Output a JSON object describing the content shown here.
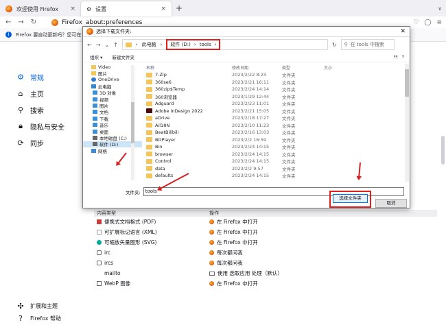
{
  "tabs": [
    {
      "title": "欢迎使用 Firefox"
    },
    {
      "title": "设置"
    }
  ],
  "nav": {
    "identity": "Firefox",
    "url": "about:preferences"
  },
  "notice": {
    "text": "Firefox 要自动更新吗？您可在 Firefox 重启时通过弹出窗口完成更新"
  },
  "sidebar": {
    "items": [
      {
        "label": "常规",
        "icon": "gear-icon"
      },
      {
        "label": "主页",
        "icon": "home-icon"
      },
      {
        "label": "搜索",
        "icon": "search-icon"
      },
      {
        "label": "隐私与安全",
        "icon": "lock-icon"
      },
      {
        "label": "同步",
        "icon": "sync-icon"
      }
    ],
    "bottom": [
      {
        "label": "扩展和主题",
        "icon": "puzzle-icon"
      },
      {
        "label": "Firefox 帮助",
        "icon": "help-icon"
      }
    ]
  },
  "content_table": {
    "col1": "内容类型",
    "col2": "操作",
    "rows": [
      {
        "type": "便携式文档格式 (PDF)",
        "action": "在 Firefox 中打开"
      },
      {
        "type": "可扩展标记语言 (XML)",
        "action": "在 Firefox 中打开"
      },
      {
        "type": "可缩放矢量图形 (SVG)",
        "action": "在 Firefox 中打开"
      },
      {
        "type": "irc",
        "action": "每次都问我"
      },
      {
        "type": "ircs",
        "action": "每次都问我"
      },
      {
        "type": "mailto",
        "action": "使用 选取应用 处理（默认）"
      },
      {
        "type": "WebP 图像",
        "action": "在 Firefox 中打开"
      }
    ]
  },
  "dialog": {
    "title": "选择下载文件夹:",
    "crumb": {
      "root": "此电脑",
      "drive": "软件 (D:)",
      "folder": "tools"
    },
    "search_placeholder": "在 tools 中搜索",
    "toolbar": {
      "organize": "组织 ▾",
      "new_folder": "新建文件夹"
    },
    "tree": [
      {
        "label": "Video",
        "icon": "folder"
      },
      {
        "label": "图片",
        "icon": "folder"
      },
      {
        "label": "OneDrive",
        "icon": "cloud"
      },
      {
        "label": "此电脑",
        "icon": "pc"
      },
      {
        "label": "3D 对象",
        "icon": "blue"
      },
      {
        "label": "视频",
        "icon": "blue"
      },
      {
        "label": "图片",
        "icon": "blue"
      },
      {
        "label": "文档",
        "icon": "blue"
      },
      {
        "label": "下载",
        "icon": "blue"
      },
      {
        "label": "音乐",
        "icon": "blue"
      },
      {
        "label": "桌面",
        "icon": "blue"
      },
      {
        "label": "本地磁盘 (C:)",
        "icon": "drive"
      },
      {
        "label": "软件 (D:)",
        "icon": "drive",
        "selected": true
      },
      {
        "label": "网络",
        "icon": "net"
      }
    ],
    "columns": [
      "名称",
      "修改日期",
      "类型",
      "大小"
    ],
    "files": [
      {
        "name": "7-Zip",
        "date": "2023/2/22 8:23",
        "type": "文件夹"
      },
      {
        "name": "360se6",
        "date": "2023/2/21 16:11",
        "type": "文件夹"
      },
      {
        "name": "360zip$Temp",
        "date": "2023/2/24 14:14",
        "type": "文件夹"
      },
      {
        "name": "360浏览器",
        "date": "2023/1/29 12:44",
        "type": "文件夹"
      },
      {
        "name": "Adguard",
        "date": "2023/2/23 11:01",
        "type": "文件夹"
      },
      {
        "name": "Adobe InDesign 2022",
        "date": "2023/2/21 15:05",
        "type": "文件夹"
      },
      {
        "name": "aDrive",
        "date": "2023/2/18 17:27",
        "type": "文件夹"
      },
      {
        "name": "Ail18N",
        "date": "2023/2/10 11:23",
        "type": "文件夹"
      },
      {
        "name": "BeatBilibili",
        "date": "2023/2/16 13:03",
        "type": "文件夹"
      },
      {
        "name": "BDPlayer",
        "date": "2023/2/2 16:59",
        "type": "文件夹"
      },
      {
        "name": "Bin",
        "date": "2023/2/24 14:15",
        "type": "文件夹"
      },
      {
        "name": "browser",
        "date": "2023/2/24 14:15",
        "type": "文件夹"
      },
      {
        "name": "Control",
        "date": "2023/2/24 14:15",
        "type": "文件夹"
      },
      {
        "name": "data",
        "date": "2023/2/2 9:57",
        "type": "文件夹"
      },
      {
        "name": "defaults",
        "date": "2023/2/24 14:15",
        "type": "文件夹"
      }
    ],
    "folder_label": "文件夹:",
    "folder_value": "tools",
    "select_button": "选择文件夹",
    "cancel_button": "取消"
  }
}
